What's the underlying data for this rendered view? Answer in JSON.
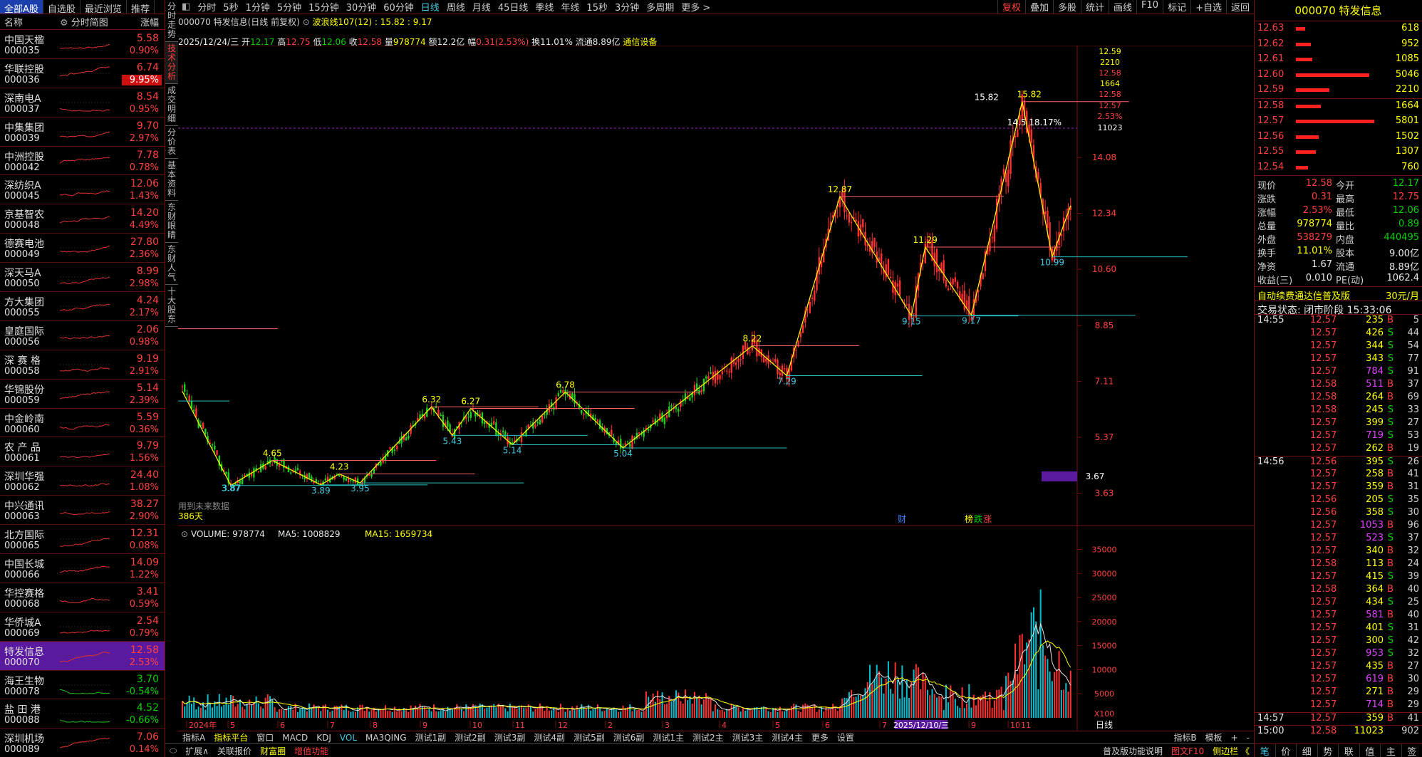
{
  "left_panel": {
    "tabs": [
      "全部A股",
      "自选股",
      "最近浏览",
      "推荐"
    ],
    "header": {
      "name": "名称",
      "spark": "分时简图",
      "chg": "涨幅"
    },
    "stocks": [
      {
        "name": "中国天楹",
        "code": "000035",
        "price": "5.58",
        "chg": "0.90%",
        "dir": "up"
      },
      {
        "name": "华联控股",
        "code": "000036",
        "price": "6.74",
        "chg": "9.95%",
        "dir": "up",
        "limit": true
      },
      {
        "name": "深南电A",
        "code": "000037",
        "price": "8.54",
        "chg": "0.95%",
        "dir": "up"
      },
      {
        "name": "中集集团",
        "code": "000039",
        "price": "9.70",
        "chg": "2.97%",
        "dir": "up"
      },
      {
        "name": "中洲控股",
        "code": "000042",
        "price": "7.78",
        "chg": "0.78%",
        "dir": "up"
      },
      {
        "name": "深纺织A",
        "code": "000045",
        "price": "12.06",
        "chg": "1.43%",
        "dir": "up"
      },
      {
        "name": "京基智农",
        "code": "000048",
        "price": "14.20",
        "chg": "4.49%",
        "dir": "up"
      },
      {
        "name": "德赛电池",
        "code": "000049",
        "price": "27.80",
        "chg": "2.36%",
        "dir": "up"
      },
      {
        "name": "深天马A",
        "code": "000050",
        "price": "8.99",
        "chg": "2.98%",
        "dir": "up"
      },
      {
        "name": "方大集团",
        "code": "000055",
        "price": "4.24",
        "chg": "2.17%",
        "dir": "up"
      },
      {
        "name": "皇庭国际",
        "code": "000056",
        "price": "2.06",
        "chg": "0.98%",
        "dir": "up"
      },
      {
        "name": "深 赛 格",
        "code": "000058",
        "price": "9.19",
        "chg": "2.91%",
        "dir": "up"
      },
      {
        "name": "华锦股份",
        "code": "000059",
        "price": "5.14",
        "chg": "2.39%",
        "dir": "up"
      },
      {
        "name": "中金岭南",
        "code": "000060",
        "price": "5.59",
        "chg": "0.36%",
        "dir": "up"
      },
      {
        "name": "农 产 品",
        "code": "000061",
        "price": "9.79",
        "chg": "1.56%",
        "dir": "up"
      },
      {
        "name": "深圳华强",
        "code": "000062",
        "price": "24.40",
        "chg": "1.08%",
        "dir": "up"
      },
      {
        "name": "中兴通讯",
        "code": "000063",
        "price": "38.27",
        "chg": "2.90%",
        "dir": "up"
      },
      {
        "name": "北方国际",
        "code": "000065",
        "price": "12.31",
        "chg": "0.08%",
        "dir": "up"
      },
      {
        "name": "中国长城",
        "code": "000066",
        "price": "14.09",
        "chg": "1.22%",
        "dir": "up"
      },
      {
        "name": "华控赛格",
        "code": "000068",
        "price": "3.41",
        "chg": "0.59%",
        "dir": "up"
      },
      {
        "name": "华侨城A",
        "code": "000069",
        "price": "2.54",
        "chg": "0.79%",
        "dir": "up"
      },
      {
        "name": "特发信息",
        "code": "000070",
        "price": "12.58",
        "chg": "2.53%",
        "dir": "up",
        "selected": true
      },
      {
        "name": "海王生物",
        "code": "000078",
        "price": "3.70",
        "chg": "-0.54%",
        "dir": "dn"
      },
      {
        "name": "盐 田 港",
        "code": "000088",
        "price": "4.52",
        "chg": "-0.66%",
        "dir": "dn"
      },
      {
        "name": "深圳机场",
        "code": "000089",
        "price": "7.06",
        "chg": "0.14%",
        "dir": "up"
      }
    ]
  },
  "vtabs": [
    "分时走势",
    "技术分析",
    "成交明细",
    "分价表",
    "基本资料",
    "东财眼睛",
    "东财人气",
    "十大股东"
  ],
  "toolbar": {
    "periods": [
      "分时",
      "5秒",
      "1分钟",
      "5分钟",
      "15分钟",
      "30分钟",
      "60分钟",
      "日线",
      "周线",
      "月线",
      "45日线",
      "季线",
      "年线",
      "15秒",
      "3分钟",
      "多周期",
      "更多 >"
    ],
    "active": "日线",
    "right": [
      "复权",
      "叠加",
      "多股",
      "统计",
      "画线",
      "F10",
      "标记",
      "+自选",
      "返回"
    ]
  },
  "chart_header": {
    "title": "000070 特发信息(日线 前复权)",
    "wave": "波浪线107(12) : 15.82 : 9.17",
    "date": "2025/12/24/三",
    "open_lbl": "开",
    "open": "12.17",
    "high_lbl": "高",
    "high": "12.75",
    "low_lbl": "低",
    "low": "12.06",
    "close_lbl": "收",
    "close": "12.58",
    "vol_lbl": "量",
    "vol": "978774",
    "amt_lbl": "额",
    "amt": "12.2亿",
    "amp_lbl": "幅",
    "amp": "0.31(2.53%)",
    "turn_lbl": "换",
    "turn": "11.01%",
    "float_lbl": "流通",
    "float": "8.89亿",
    "sector": "通信设备"
  },
  "price_axis": {
    "labels": [
      "12.59",
      "2210",
      "12.58",
      "1664",
      "12.58",
      "12.57",
      "2.53%",
      "11023",
      "14.08",
      "12.34",
      "10.60",
      "8.85",
      "7.11",
      "5.37",
      "3.63"
    ],
    "ticks": [
      "14.08",
      "12.34",
      "10.60",
      "8.85",
      "7.11",
      "5.37",
      "3.63"
    ],
    "current_marker": "3.67",
    "pct_label": "14.5 18.17%"
  },
  "wave_labels": [
    "3.87",
    "3.87",
    "4.65",
    "3.89",
    "4.23",
    "3.95",
    "6.32",
    "5.43",
    "6.27",
    "5.14",
    "6.78",
    "5.04",
    "8.22",
    "7.29",
    "12.87",
    "9.15",
    "11.29",
    "9.17",
    "15.82",
    "15.82",
    "10.99"
  ],
  "chart_notes": {
    "future": "用到未来数据",
    "days": "386天",
    "fin": "财",
    "bang": "榜",
    "die": "跌",
    "zhang": "涨"
  },
  "volume": {
    "header": "VOLUME: 978774",
    "ma5": "MA5: 1008829",
    "ma15": "MA15: 1659734",
    "axis": [
      "35000",
      "30000",
      "25000",
      "20000",
      "15000",
      "10000",
      "5000",
      "X100"
    ],
    "months": [
      "2024年",
      "5",
      "6",
      "7",
      "8",
      "9",
      "10",
      "11",
      "12",
      "2",
      "3",
      "4",
      "5",
      "6",
      "7",
      "8",
      "9",
      "10",
      "11"
    ],
    "date_marker": "2025/12/10/三",
    "period_lbl": "日线"
  },
  "indicator_bar": [
    "指标A",
    "指标平台",
    "窗口",
    "MACD",
    "KDJ",
    "VOL",
    "MA3QING",
    "测试1副",
    "测试2副",
    "测试3副",
    "测试4副",
    "测试5副",
    "测试6副",
    "测试1主",
    "测试2主",
    "测试3主",
    "测试4主",
    "更多",
    "设置",
    "指标B",
    "模板",
    "+",
    "-"
  ],
  "status_bar": [
    "扩展∧",
    "关联报价",
    "财富圈",
    "增值功能",
    "普及版功能说明",
    "图文F10",
    "侧边栏 《"
  ],
  "right_panel": {
    "title": "000070 特发信息",
    "asks": [
      {
        "price": "12.63",
        "vol": "618",
        "bar": 0.12
      },
      {
        "price": "12.62",
        "vol": "952",
        "bar": 0.19
      },
      {
        "price": "12.61",
        "vol": "1085",
        "bar": 0.21
      },
      {
        "price": "12.60",
        "vol": "5046",
        "bar": 0.94
      },
      {
        "price": "12.59",
        "vol": "2210",
        "bar": 0.43
      }
    ],
    "bids": [
      {
        "price": "12.58",
        "vol": "1664",
        "bar": 0.32
      },
      {
        "price": "12.57",
        "vol": "5801",
        "bar": 1.0
      },
      {
        "price": "12.56",
        "vol": "1502",
        "bar": 0.29
      },
      {
        "price": "12.55",
        "vol": "1307",
        "bar": 0.25
      },
      {
        "price": "12.54",
        "vol": "760",
        "bar": 0.15
      }
    ],
    "quote": [
      {
        "l1": "现价",
        "v1": "12.58",
        "c1": "up",
        "l2": "今开",
        "v2": "12.17",
        "c2": "dn"
      },
      {
        "l1": "涨跌",
        "v1": "0.31",
        "c1": "up",
        "l2": "最高",
        "v2": "12.75",
        "c2": "up"
      },
      {
        "l1": "涨幅",
        "v1": "2.53%",
        "c1": "up",
        "l2": "最低",
        "v2": "12.06",
        "c2": "dn"
      },
      {
        "l1": "总量",
        "v1": "978774",
        "c1": "yl",
        "l2": "量比",
        "v2": "0.89",
        "c2": "dn"
      },
      {
        "l1": "外盘",
        "v1": "538279",
        "c1": "up",
        "l2": "内盘",
        "v2": "440495",
        "c2": "dn"
      },
      {
        "l1": "换手",
        "v1": "11.01%",
        "c1": "yl",
        "l2": "股本",
        "v2": "9.00亿",
        "c2": "wh"
      },
      {
        "l1": "净资",
        "v1": "1.67",
        "c1": "wh",
        "l2": "流通",
        "v2": "8.89亿",
        "c2": "wh"
      },
      {
        "l1": "收益(三)",
        "v1": "0.010",
        "c1": "wh",
        "l2": "PE(动)",
        "v2": "1062.4",
        "c2": "wh"
      }
    ],
    "promo": "自动续费通达信普及版",
    "promo_price": "30元/月",
    "trade_state": "交易状态: 闭市阶段 15:33:06",
    "ticks": [
      {
        "t": "14:55",
        "p": "12.57",
        "v": "235",
        "bs": "B",
        "n": "5",
        "m": false
      },
      {
        "t": "",
        "p": "12.57",
        "v": "426",
        "bs": "S",
        "n": "44",
        "m": false
      },
      {
        "t": "",
        "p": "12.57",
        "v": "344",
        "bs": "S",
        "n": "54",
        "m": false
      },
      {
        "t": "",
        "p": "12.57",
        "v": "343",
        "bs": "S",
        "n": "77",
        "m": false
      },
      {
        "t": "",
        "p": "12.57",
        "v": "784",
        "bs": "S",
        "n": "91",
        "m": true
      },
      {
        "t": "",
        "p": "12.58",
        "v": "511",
        "bs": "B",
        "n": "37",
        "m": true
      },
      {
        "t": "",
        "p": "12.58",
        "v": "264",
        "bs": "B",
        "n": "69",
        "m": false
      },
      {
        "t": "",
        "p": "12.58",
        "v": "245",
        "bs": "S",
        "n": "33",
        "m": false
      },
      {
        "t": "",
        "p": "12.57",
        "v": "399",
        "bs": "S",
        "n": "27",
        "m": false
      },
      {
        "t": "",
        "p": "12.57",
        "v": "719",
        "bs": "S",
        "n": "53",
        "m": true
      },
      {
        "t": "",
        "p": "12.57",
        "v": "262",
        "bs": "B",
        "n": "19",
        "m": false
      },
      {
        "t": "14:56",
        "p": "12.56",
        "v": "395",
        "bs": "S",
        "n": "26",
        "m": false
      },
      {
        "t": "",
        "p": "12.57",
        "v": "258",
        "bs": "B",
        "n": "41",
        "m": false
      },
      {
        "t": "",
        "p": "12.57",
        "v": "359",
        "bs": "B",
        "n": "31",
        "m": false
      },
      {
        "t": "",
        "p": "12.56",
        "v": "205",
        "bs": "S",
        "n": "35",
        "m": false
      },
      {
        "t": "",
        "p": "12.56",
        "v": "358",
        "bs": "S",
        "n": "30",
        "m": false
      },
      {
        "t": "",
        "p": "12.57",
        "v": "1053",
        "bs": "B",
        "n": "96",
        "m": true
      },
      {
        "t": "",
        "p": "12.57",
        "v": "523",
        "bs": "S",
        "n": "37",
        "m": true
      },
      {
        "t": "",
        "p": "12.57",
        "v": "340",
        "bs": "B",
        "n": "32",
        "m": false
      },
      {
        "t": "",
        "p": "12.58",
        "v": "113",
        "bs": "B",
        "n": "24",
        "m": false
      },
      {
        "t": "",
        "p": "12.57",
        "v": "415",
        "bs": "S",
        "n": "39",
        "m": false
      },
      {
        "t": "",
        "p": "12.58",
        "v": "364",
        "bs": "B",
        "n": "40",
        "m": false
      },
      {
        "t": "",
        "p": "12.57",
        "v": "434",
        "bs": "S",
        "n": "25",
        "m": false
      },
      {
        "t": "",
        "p": "12.57",
        "v": "581",
        "bs": "B",
        "n": "40",
        "m": true
      },
      {
        "t": "",
        "p": "12.57",
        "v": "401",
        "bs": "S",
        "n": "31",
        "m": false
      },
      {
        "t": "",
        "p": "12.57",
        "v": "300",
        "bs": "S",
        "n": "42",
        "m": false
      },
      {
        "t": "",
        "p": "12.57",
        "v": "953",
        "bs": "S",
        "n": "32",
        "m": true
      },
      {
        "t": "",
        "p": "12.57",
        "v": "435",
        "bs": "B",
        "n": "27",
        "m": false
      },
      {
        "t": "",
        "p": "12.57",
        "v": "619",
        "bs": "B",
        "n": "30",
        "m": true
      },
      {
        "t": "",
        "p": "12.57",
        "v": "271",
        "bs": "B",
        "n": "29",
        "m": false
      },
      {
        "t": "",
        "p": "12.57",
        "v": "714",
        "bs": "B",
        "n": "29",
        "m": true
      },
      {
        "t": "14:57",
        "p": "12.57",
        "v": "359",
        "bs": "B",
        "n": "41",
        "m": false
      },
      {
        "t": "15:00",
        "p": "12.58",
        "v": "11023",
        "bs": "",
        "n": "902",
        "m": false
      }
    ],
    "bottom_tabs": [
      "笔",
      "价",
      "细",
      "势",
      "联",
      "值",
      "主",
      "签"
    ]
  },
  "chart_data": {
    "type": "line",
    "title": "000070 特发信息(日线 前复权)",
    "xlabel": "",
    "ylabel": "",
    "ylim": [
      3.63,
      15.82
    ],
    "series": [
      {
        "name": "波浪线107(12)",
        "x": [
          "2024-05",
          "2024-06",
          "2024-07",
          "2024-08",
          "2024-09",
          "2024-09",
          "2024-10",
          "2024-11",
          "2024-12",
          "2025-02",
          "2025-03",
          "2025-04",
          "2025-06",
          "2025-07",
          "2025-08",
          "2025-09",
          "2025-10",
          "2025-11",
          "2025-11",
          "2025-12",
          "2025-12"
        ],
        "values": [
          6.8,
          3.87,
          4.65,
          3.89,
          4.23,
          3.95,
          6.32,
          5.43,
          6.27,
          5.14,
          6.78,
          5.04,
          8.22,
          7.29,
          12.87,
          9.15,
          11.29,
          9.17,
          15.82,
          10.99,
          12.58
        ]
      }
    ],
    "volume_ylim": [
      0,
      35000
    ],
    "volume_unit": "X100"
  }
}
